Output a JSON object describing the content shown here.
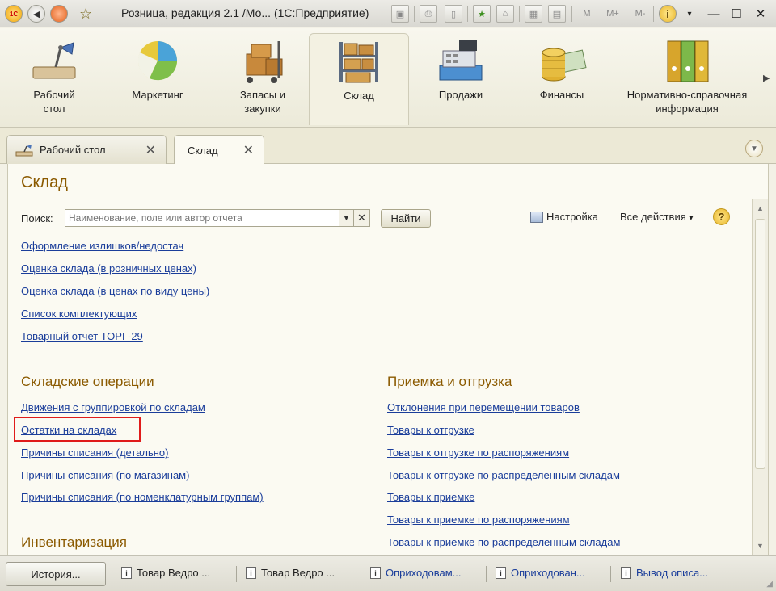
{
  "window": {
    "title": "Розница, редакция 2.1 /Мо...  (1С:Предприятие)",
    "toolbar_letters": [
      "M",
      "M+",
      "M-"
    ],
    "help_glyph": "i"
  },
  "sections": [
    {
      "id": "desktop",
      "label_line1": "Рабочий",
      "label_line2": "стол",
      "icon": "desk-lamp-icon"
    },
    {
      "id": "marketing",
      "label_line1": "Маркетинг",
      "label_line2": "",
      "icon": "pie-chart-icon"
    },
    {
      "id": "stock",
      "label_line1": "Запасы и",
      "label_line2": "закупки",
      "icon": "boxes-cart-icon"
    },
    {
      "id": "warehouse",
      "label_line1": "Склад",
      "label_line2": "",
      "icon": "warehouse-shelves-icon",
      "active": true
    },
    {
      "id": "sales",
      "label_line1": "Продажи",
      "label_line2": "",
      "icon": "cash-register-icon"
    },
    {
      "id": "finance",
      "label_line1": "Финансы",
      "label_line2": "",
      "icon": "coins-icon"
    },
    {
      "id": "reference",
      "label_line1": "Нормативно-справочная",
      "label_line2": "информация",
      "icon": "binders-icon"
    }
  ],
  "tabs": [
    {
      "label": "Рабочий стол",
      "close": "✕"
    },
    {
      "label": "Склад",
      "close": "✕",
      "active": true
    }
  ],
  "page": {
    "title": "Склад",
    "search_label": "Поиск:",
    "search_placeholder": "Наименование, поле или автор отчета",
    "search_value": "",
    "find_button": "Найти",
    "settings": "Настройка",
    "all_actions": "Все действия",
    "all_actions_arrow": "▾",
    "help": "?"
  },
  "top_links": [
    "Оформление излишков/недостач",
    "Оценка склада (в розничных ценах)",
    "Оценка склада (в ценах по виду цены)",
    "Список комплектующих",
    "Товарный отчет ТОРГ-29"
  ],
  "groups": {
    "warehouse_ops": {
      "title": "Складские операции",
      "links": [
        "Движения с группировкой по складам",
        "Остатки на складах",
        "Причины списания (детально)",
        "Причины списания (по магазинам)",
        "Причины списания (по номенклатурным группам)"
      ]
    },
    "inventory": {
      "title": "Инвентаризация"
    },
    "receiving": {
      "title": "Приемка и отгрузка",
      "links": [
        "Отклонения при перемещении товаров",
        "Товары к отгрузке",
        "Товары к отгрузке по распоряжениям",
        "Товары к отгрузке по распределенным складам",
        "Товары к приемке",
        "Товары к приемке по распоряжениям",
        "Товары к приемке по распределенным складам"
      ]
    }
  },
  "highlighted_link": "Остатки на складах",
  "taskbar": {
    "history": "История...",
    "items": [
      {
        "label": "Товар Ведро ...",
        "open": false
      },
      {
        "label": "Товар Ведро ...",
        "open": false
      },
      {
        "label": "Оприходовам...",
        "open": true
      },
      {
        "label": "Оприходован...",
        "open": true
      },
      {
        "label": "Вывод описа...",
        "open": true
      }
    ]
  },
  "colors": {
    "accent_title": "#8b5a00",
    "link": "#1a3d9a",
    "highlight_border": "#e01b1b",
    "background": "#fbfaf2"
  }
}
